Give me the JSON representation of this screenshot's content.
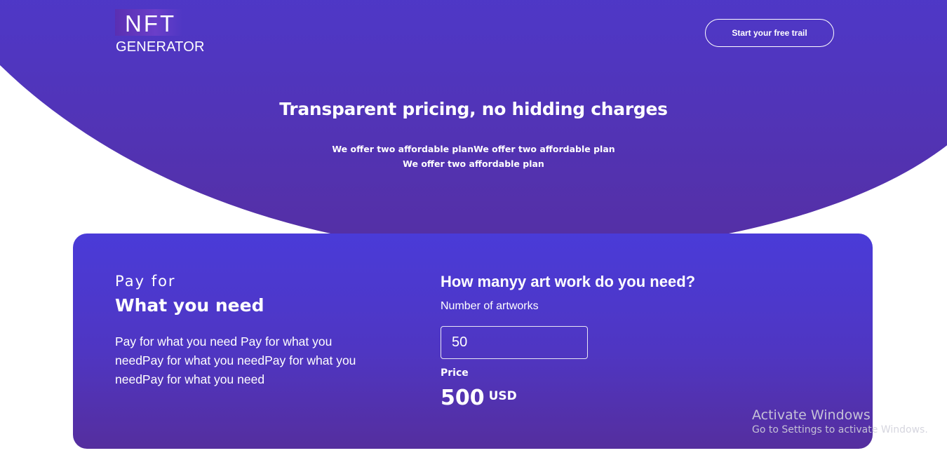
{
  "header": {
    "logo": {
      "line1": "NFT",
      "line2": "GENERATOR"
    },
    "cta_label": "Start your free trail"
  },
  "hero": {
    "headline": "Transparent pricing, no hidding charges",
    "subtitle_line1": "We offer two affordable planWe offer two affordable plan",
    "subtitle_line2": "We offer two affordable plan"
  },
  "pricing_card": {
    "left": {
      "eyebrow": "Pay for",
      "title": "What you need",
      "description": "Pay for what you need Pay for what you needPay for what you needPay for what you needPay for what you need"
    },
    "right": {
      "question": "How manyy art work do you need?",
      "artworks_label": "Number of artworks",
      "artworks_value": "50",
      "price_label": "Price",
      "price_value": "500",
      "price_currency": "USD"
    }
  },
  "os_watermark": {
    "title": "Activate Windows",
    "subtitle": "Go to Settings to activate Windows."
  },
  "colors": {
    "brand_gradient_top": "#4a3bd6",
    "brand_gradient_bottom": "#552fa3",
    "text_on_brand": "#ffffff",
    "background": "#ffffff"
  }
}
